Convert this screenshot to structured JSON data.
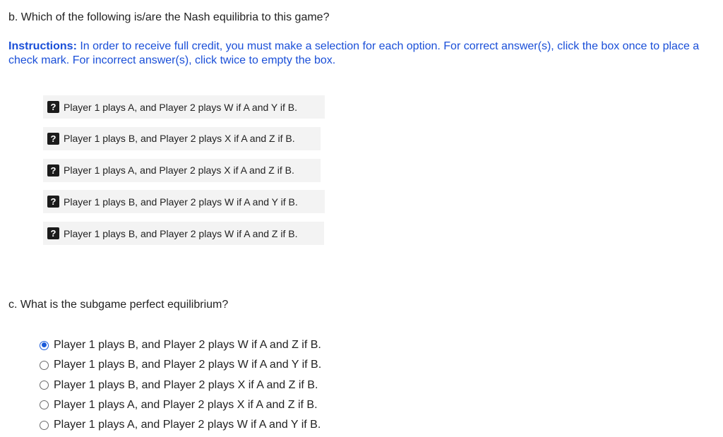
{
  "question_b": {
    "prompt": "b. Which of the following is/are the Nash equilibria to this game?",
    "instructions_label": "Instructions:",
    "instructions_text": "In order to receive full credit, you must make a selection for each option. For correct answer(s), click the box once to place a check mark. For incorrect answer(s), click twice to empty the box.",
    "box_glyph": "?",
    "options": [
      {
        "label": "Player 1 plays A, and Player 2 plays W if A and Y if B.",
        "state": "unanswered"
      },
      {
        "label": "Player 1 plays B, and Player 2 plays X if A and Z if B.",
        "state": "unanswered"
      },
      {
        "label": "Player 1 plays A, and Player 2 plays X if A and Z if B.",
        "state": "unanswered"
      },
      {
        "label": "Player 1 plays B, and Player 2 plays W if A and Y if B.",
        "state": "unanswered"
      },
      {
        "label": "Player 1 plays B, and Player 2 plays W if A and Z if B.",
        "state": "unanswered"
      }
    ]
  },
  "question_c": {
    "prompt": "c. What is the subgame perfect equilibrium?",
    "options": [
      {
        "label": "Player 1 plays B, and Player 2 plays W if A and Z if B.",
        "selected": true
      },
      {
        "label": "Player 1 plays B, and Player 2 plays W if A and Y if B.",
        "selected": false
      },
      {
        "label": "Player 1 plays B, and Player 2 plays X if A and Z if B.",
        "selected": false
      },
      {
        "label": "Player 1 plays A, and Player 2 plays X if A and Z if B.",
        "selected": false
      },
      {
        "label": "Player 1 plays A, and Player 2 plays W if A and Y if B.",
        "selected": false
      }
    ]
  },
  "colors": {
    "instructions_blue": "#1a4fd8",
    "radio_selected": "#1a5ad9",
    "option_background": "#f3f3f3"
  },
  "icons": {
    "check_box": "question-mark-box-icon",
    "radio": "radio-button-icon"
  }
}
